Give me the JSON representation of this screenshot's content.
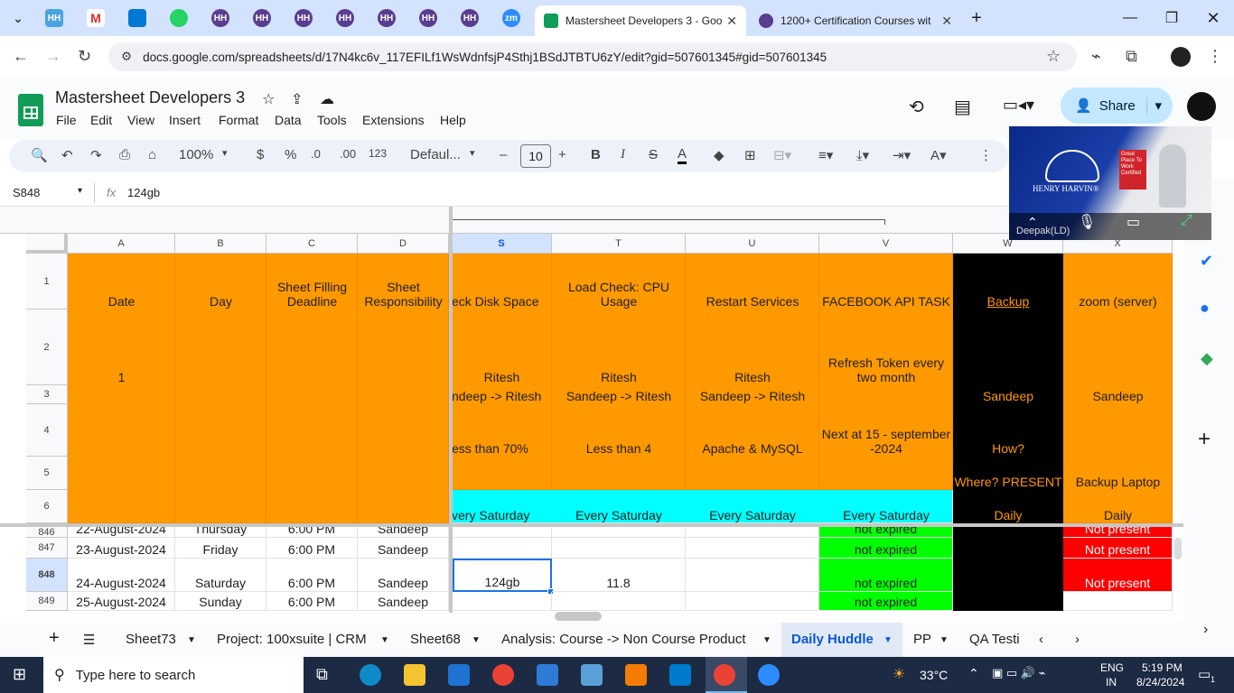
{
  "browser": {
    "pinned_tabs": [
      "Henry Harvin",
      "Gmail",
      "Microsoft",
      "WhatsApp",
      "Henry Harvin",
      "Henry Harvin",
      "Henry Harvin",
      "Henry Harvin",
      "Henry Harvin",
      "Henry Harvin",
      "Henry Harvin",
      "Zoom"
    ],
    "pinned_labels": {
      "hh": "HH",
      "zm": "zm",
      "gmail": "M"
    },
    "tabs": [
      {
        "title": "Mastersheet Developers 3 - Goo",
        "active": true
      },
      {
        "title": "1200+ Certification Courses wit",
        "active": false
      }
    ],
    "new_tab": "+",
    "url": "docs.google.com/spreadsheets/d/17N4kc6v_117EFILf1WsWdnfsjP4Sthj1BSdJTBTU6zY/edit?gid=507601345#gid=507601345"
  },
  "sheets": {
    "title": "Mastersheet Developers 3",
    "menu": [
      "File",
      "Edit",
      "View",
      "Insert",
      "Format",
      "Data",
      "Tools",
      "Extensions",
      "Help"
    ],
    "share_label": "Share",
    "toolbar": {
      "zoom": "100%",
      "currency": "$",
      "percent": "%",
      "dec_minus": ".0",
      "dec_plus": ".00",
      "format_num": "123",
      "font": "Defaul...",
      "font_size": "10",
      "bold": "B",
      "italic": "I",
      "strike": "S",
      "text_color": "A",
      "minus": "–",
      "plus": "+"
    },
    "name_box": "S848",
    "fx": "fx",
    "formula": "124gb",
    "columns": [
      "A",
      "B",
      "C",
      "D",
      "S",
      "T",
      "U",
      "V",
      "W",
      "X"
    ],
    "header_rows": [
      "1",
      "2",
      "3",
      "4",
      "5",
      "6"
    ],
    "data_rows": [
      "846",
      "847",
      "848",
      "849"
    ],
    "r1": {
      "A": "Date",
      "B": "Day",
      "C": "Sheet Filling Deadline",
      "D": "Sheet Responsibility",
      "S": "eck Disk Space",
      "T": "Load Check: CPU Usage",
      "U": "Restart Services",
      "V": "FACEBOOK API TASK",
      "W": "Backup",
      "X": "zoom (server)"
    },
    "r2": {
      "A": "1",
      "S": "Ritesh",
      "T": "Ritesh",
      "U": "Ritesh",
      "V": "Refresh Token every two month"
    },
    "r3": {
      "S": "ndeep -> Ritesh",
      "T": "Sandeep -> Ritesh",
      "U": "Sandeep -> Ritesh",
      "W": "Sandeep",
      "X": "Sandeep"
    },
    "r4": {
      "S": "ess than 70%",
      "T": "Less than 4",
      "U": "Apache & MySQL",
      "V": "Next at 15 - september -2024",
      "W": "How?"
    },
    "r5": {
      "W": "Where? PRESENT",
      "X": "Backup Laptop"
    },
    "r6": {
      "S": "very Saturday",
      "T": "Every Saturday",
      "U": "Every Saturday",
      "V": "Every Saturday",
      "W": "Daily",
      "X": "Daily"
    },
    "d846": {
      "A": "22-August-2024",
      "B": "Thursday",
      "C": "6:00 PM",
      "D": "Sandeep",
      "V": "not expired",
      "X": "Not present"
    },
    "d847": {
      "A": "23-August-2024",
      "B": "Friday",
      "C": "6:00 PM",
      "D": "Sandeep",
      "V": "not expired",
      "X": "Not present"
    },
    "d848": {
      "A": "24-August-2024",
      "B": "Saturday",
      "C": "6:00 PM",
      "D": "Sandeep",
      "S": "124gb",
      "T": "11.8",
      "V": "not expired",
      "X": "Not present"
    },
    "d849": {
      "A": "25-August-2024",
      "B": "Sunday",
      "C": "6:00 PM",
      "D": "Sandeep",
      "V": "not expired"
    },
    "sheet_tabs": [
      "Sheet73",
      "Project: 100xsuite | CRM",
      "Sheet68",
      "Analysis: Course -> Non Course Product",
      "Daily Huddle",
      "PP",
      "QA Testi"
    ],
    "active_sheet": "Daily Huddle",
    "add_sheet": "+"
  },
  "video": {
    "brand": "HENRY HARVIN®",
    "badge": "Great Place To Work Certified",
    "participant": "Deepak(LD)"
  },
  "taskbar": {
    "search_placeholder": "Type here to search",
    "weather": "33°C",
    "lang1": "ENG",
    "lang2": "IN",
    "time": "5:19 PM",
    "date": "8/24/2024",
    "notif": "1"
  },
  "colors": {
    "orange": "#ff9900",
    "cyan": "#00ffff",
    "green": "#00ff00",
    "red": "#ff0000",
    "black": "#000000",
    "share": "#c2e7ff",
    "taskbar": "#1c2a43"
  }
}
